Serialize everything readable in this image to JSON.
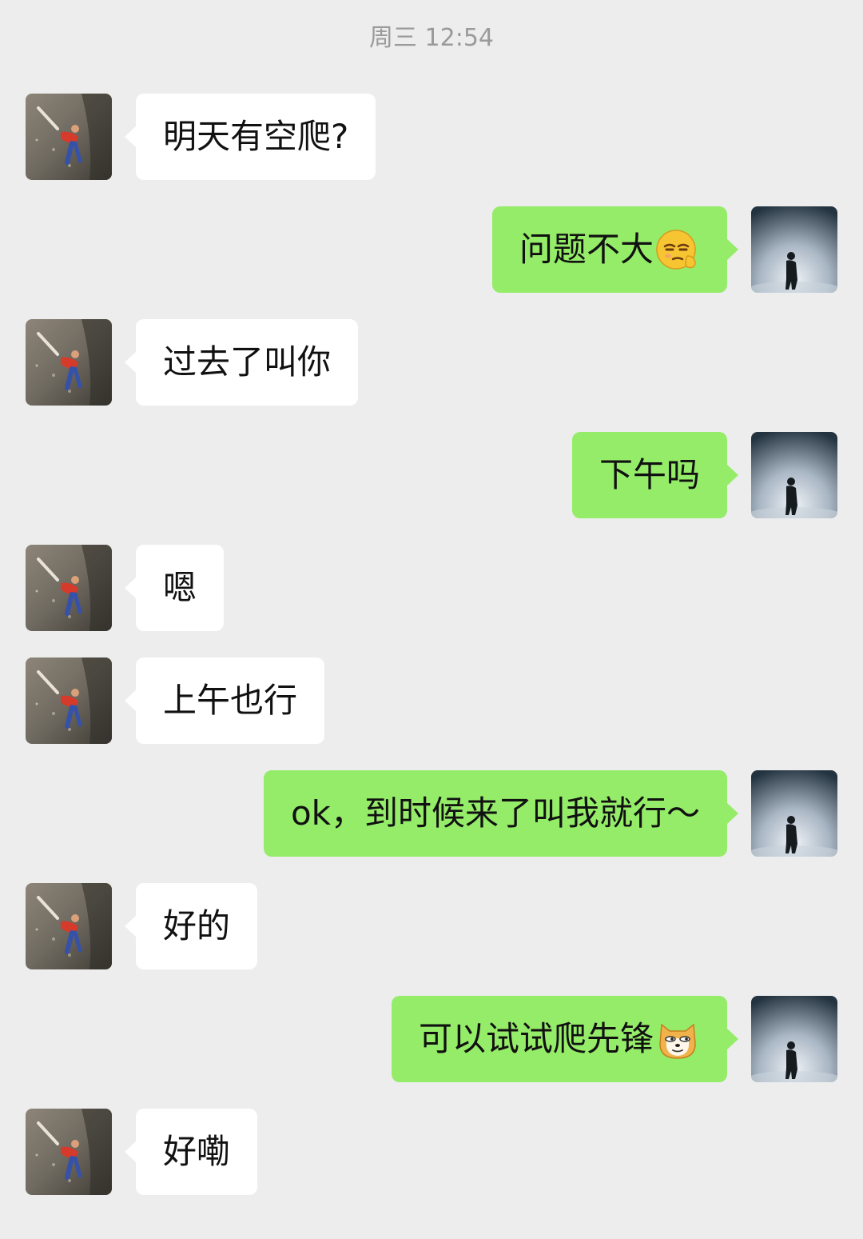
{
  "header": {
    "timestamp": "周三 12:54"
  },
  "colors": {
    "background": "#ededed",
    "incoming_bubble": "#ffffff",
    "outgoing_bubble": "#95ec69",
    "timestamp_text": "#9a9a9a"
  },
  "messages": [
    {
      "side": "left",
      "text": "明天有空爬?",
      "avatar": "climber-avatar"
    },
    {
      "side": "right",
      "text": "问题不大",
      "emoji": "smug-face-emoji",
      "avatar": "silhouette-avatar"
    },
    {
      "side": "left",
      "text": "过去了叫你",
      "avatar": "climber-avatar"
    },
    {
      "side": "right",
      "text": "下午吗",
      "avatar": "silhouette-avatar"
    },
    {
      "side": "left",
      "text": "嗯",
      "avatar": "climber-avatar"
    },
    {
      "side": "left",
      "text": "上午也行",
      "avatar": "climber-avatar"
    },
    {
      "side": "right",
      "text": "ok，到时候来了叫我就行～",
      "avatar": "silhouette-avatar"
    },
    {
      "side": "left",
      "text": "好的",
      "avatar": "climber-avatar"
    },
    {
      "side": "right",
      "text": "可以试试爬先锋",
      "emoji": "doge-emoji",
      "avatar": "silhouette-avatar"
    },
    {
      "side": "left",
      "text": "好嘞",
      "avatar": "climber-avatar"
    }
  ]
}
